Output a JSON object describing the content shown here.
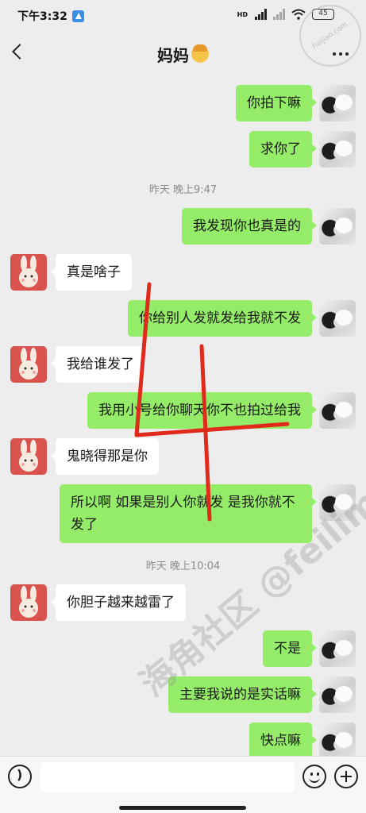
{
  "status_bar": {
    "time": "下午3:32",
    "network": "HD",
    "battery": "45"
  },
  "header": {
    "title": "妈妈"
  },
  "watermark": {
    "badge_text": "haijiao.com",
    "diagonal_text": "海角社区 @feilim"
  },
  "messages": [
    {
      "type": "out",
      "text": "你拍下嘛"
    },
    {
      "type": "out",
      "text": "求你了"
    },
    {
      "type": "time",
      "text": "昨天 晚上9:47"
    },
    {
      "type": "out",
      "text": "我发现你也真是的"
    },
    {
      "type": "in",
      "text": "真是啥子"
    },
    {
      "type": "out",
      "text": "你给别人发就发给我就不发"
    },
    {
      "type": "in",
      "text": "我给谁发了"
    },
    {
      "type": "out",
      "text": "我用小号给你聊天你不也拍过给我"
    },
    {
      "type": "in",
      "text": "鬼晓得那是你"
    },
    {
      "type": "out",
      "text": "所以啊  如果是别人你就发 是我你就不发了"
    },
    {
      "type": "time",
      "text": "昨天 晚上10:04"
    },
    {
      "type": "in",
      "text": "你胆子越来越雷了"
    },
    {
      "type": "out",
      "text": "不是"
    },
    {
      "type": "out",
      "text": "主要我说的是实话嘛"
    },
    {
      "type": "out",
      "text": "快点嘛"
    }
  ],
  "annotation": {
    "drawn_mark": "4",
    "color": "#e02a1b"
  },
  "colors": {
    "background": "#ededed",
    "outgoing_bubble": "#95ec69",
    "incoming_bubble": "#ffffff",
    "mom_avatar": "#d9534f"
  },
  "input": {
    "placeholder": ""
  }
}
